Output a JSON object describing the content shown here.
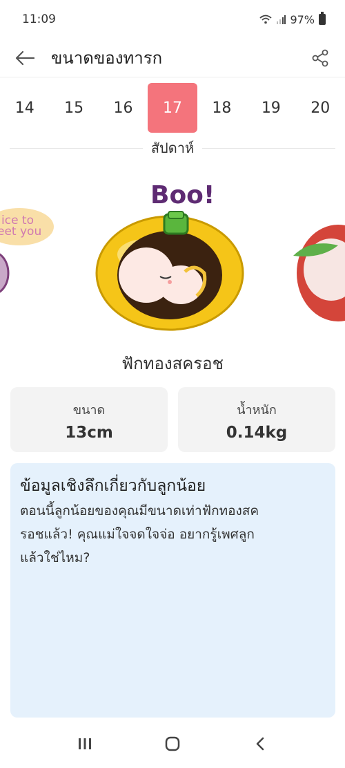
{
  "status_bar": {
    "time": "11:09",
    "battery": "97%"
  },
  "app_bar": {
    "title": "ขนาดของทารก"
  },
  "weeks": {
    "items": [
      "14",
      "15",
      "16",
      "17",
      "18",
      "19",
      "20"
    ],
    "selected": "17",
    "label": "สัปดาห์"
  },
  "hero": {
    "boo_text": "Boo!",
    "left_bubble_line1": "ice to",
    "left_bubble_line2": "eet you",
    "icon": "mangosteen-fruit-baby"
  },
  "fruit_name": "ฟักทองสครอช",
  "stats": {
    "size_label": "ขนาด",
    "size_value": "13cm",
    "weight_label": "น้ำหนัก",
    "weight_value": "0.14kg"
  },
  "insight": {
    "title": "ข้อมูลเชิงลึกเกี่ยวกับลูกน้อย",
    "body_line1": "ตอนนี้ลูกน้อยของคุณมีขนาดเท่าฟักทองสค",
    "body_line2": "รอชแล้ว! คุณแม่ใจจดใจจ่อ อยากรู้เพศลูก",
    "body_line3": "แล้วใช่ไหม?"
  },
  "colors": {
    "accent": "#f4747c",
    "card_bg": "#f3f3f3",
    "insight_bg": "#e5f1fc"
  }
}
